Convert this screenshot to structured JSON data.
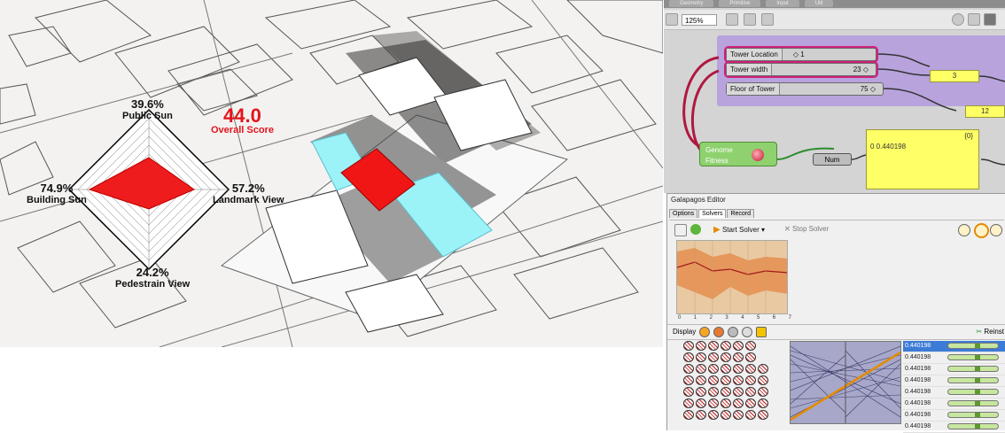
{
  "radar": {
    "top_value": "39.6%",
    "top_label": "Public Sun",
    "left_value": "74.9%",
    "left_label": "Building Sun",
    "right_value": "57.2%",
    "right_label": "Landmark View",
    "bottom_value": "24.2%",
    "bottom_label": "Pedestrain View",
    "score_value": "44.0",
    "score_label": "Overall Score"
  },
  "grasshopper": {
    "tabs": [
      "Geometry",
      "Primitive",
      "Input",
      "Util"
    ],
    "zoom": "125%",
    "sliders": [
      {
        "label": "Tower Location",
        "value": "◇ 1"
      },
      {
        "label": "Tower width",
        "value": "23 ◇"
      },
      {
        "label": "Floor of Tower",
        "value": "75 ◇"
      }
    ],
    "panels": {
      "small_a": "3",
      "small_b": "12",
      "big_header": "{0}",
      "big_row": "0 0.440198"
    },
    "genome": {
      "label1": "Genome",
      "label2": "Fitness"
    },
    "num_label": "Num"
  },
  "galapagos": {
    "title": "Galapagos Editor",
    "tabs": [
      "Options",
      "Solvers",
      "Record"
    ],
    "start_label": "Start Solver",
    "stop_label": "Stop Solver",
    "graph_ticks": [
      "0",
      "1",
      "2",
      "3",
      "4",
      "5",
      "6",
      "7"
    ],
    "display_label": "Display",
    "reinstate_label": "Reinst",
    "fitness_values": [
      "0.440198",
      "0.440198",
      "0.440198",
      "0.440198",
      "0.440198",
      "0.440198",
      "0.440198",
      "0.440198"
    ],
    "colors": {
      "selection": "#3c7bd6",
      "graph_band": "#e58b4a",
      "line": "#d06a00"
    }
  }
}
